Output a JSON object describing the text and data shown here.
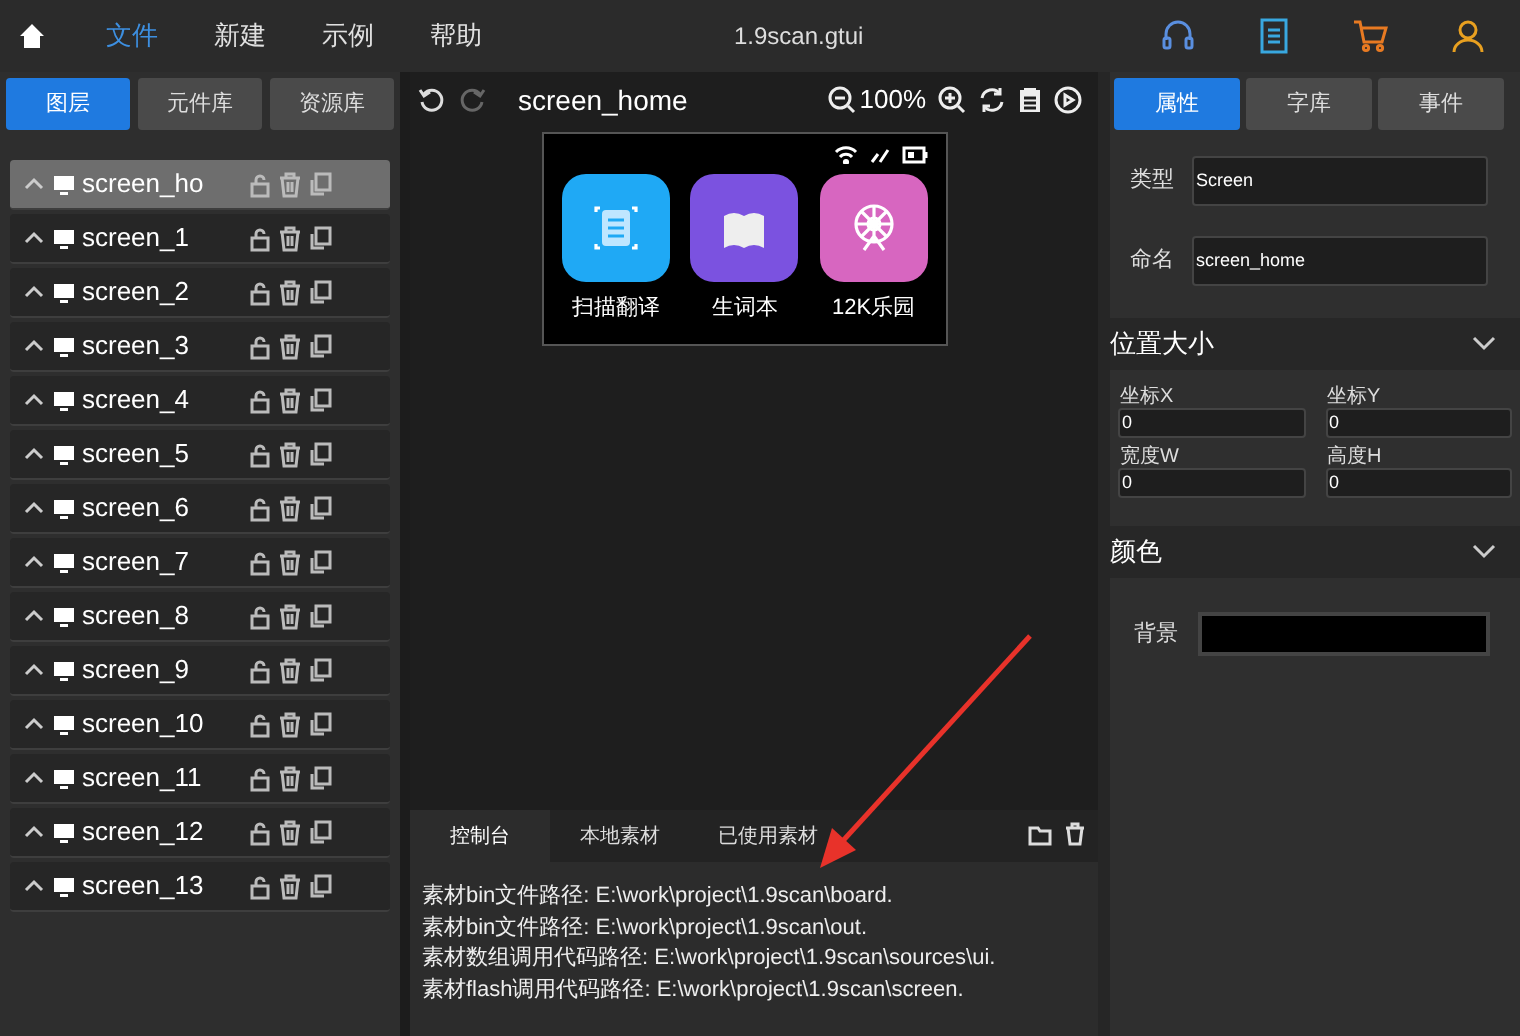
{
  "menu": {
    "items": [
      {
        "label": "文件",
        "selected": true
      },
      {
        "label": "新建",
        "selected": false
      },
      {
        "label": "示例",
        "selected": false
      },
      {
        "label": "帮助",
        "selected": false
      }
    ],
    "title": "1.9scan.gtui"
  },
  "left_tabs": [
    {
      "label": "图层",
      "selected": true
    },
    {
      "label": "元件库",
      "selected": false
    },
    {
      "label": "资源库",
      "selected": false
    }
  ],
  "layers": [
    {
      "name": "screen_ho",
      "selected": true
    },
    {
      "name": "screen_1",
      "selected": false
    },
    {
      "name": "screen_2",
      "selected": false
    },
    {
      "name": "screen_3",
      "selected": false
    },
    {
      "name": "screen_4",
      "selected": false
    },
    {
      "name": "screen_5",
      "selected": false
    },
    {
      "name": "screen_6",
      "selected": false
    },
    {
      "name": "screen_7",
      "selected": false
    },
    {
      "name": "screen_8",
      "selected": false
    },
    {
      "name": "screen_9",
      "selected": false
    },
    {
      "name": "screen_10",
      "selected": false
    },
    {
      "name": "screen_11",
      "selected": false
    },
    {
      "name": "screen_12",
      "selected": false
    },
    {
      "name": "screen_13",
      "selected": false
    }
  ],
  "canvas": {
    "screen_name": "screen_home",
    "zoom": "100%",
    "apps": [
      {
        "label": "扫描翻译",
        "color": "#1fa9f5"
      },
      {
        "label": "生词本",
        "color": "#7b52e0"
      },
      {
        "label": "12K乐园",
        "color": "#d766c0"
      }
    ]
  },
  "console": {
    "tabs": [
      {
        "label": "控制台",
        "selected": true
      },
      {
        "label": "本地素材",
        "selected": false
      },
      {
        "label": "已使用素材",
        "selected": false
      }
    ],
    "lines": [
      "素材bin文件路径: E:\\work\\project\\1.9scan\\board.",
      "素材bin文件路径: E:\\work\\project\\1.9scan\\out.",
      "素材数组调用代码路径: E:\\work\\project\\1.9scan\\sources\\ui.",
      "素材flash调用代码路径: E:\\work\\project\\1.9scan\\screen."
    ]
  },
  "right_tabs": [
    {
      "label": "属性",
      "selected": true
    },
    {
      "label": "字库",
      "selected": false
    },
    {
      "label": "事件",
      "selected": false
    }
  ],
  "properties": {
    "type_label": "类型",
    "type_value": "Screen",
    "name_label": "命名",
    "name_value": "screen_home",
    "position_section": "位置大小",
    "fields": [
      {
        "label": "坐标X",
        "value": "0"
      },
      {
        "label": "坐标Y",
        "value": "0"
      },
      {
        "label": "宽度W",
        "value": "0"
      },
      {
        "label": "高度H",
        "value": "0"
      }
    ],
    "color_section": "颜色",
    "background": {
      "label": "背景",
      "color": "#000000"
    }
  }
}
